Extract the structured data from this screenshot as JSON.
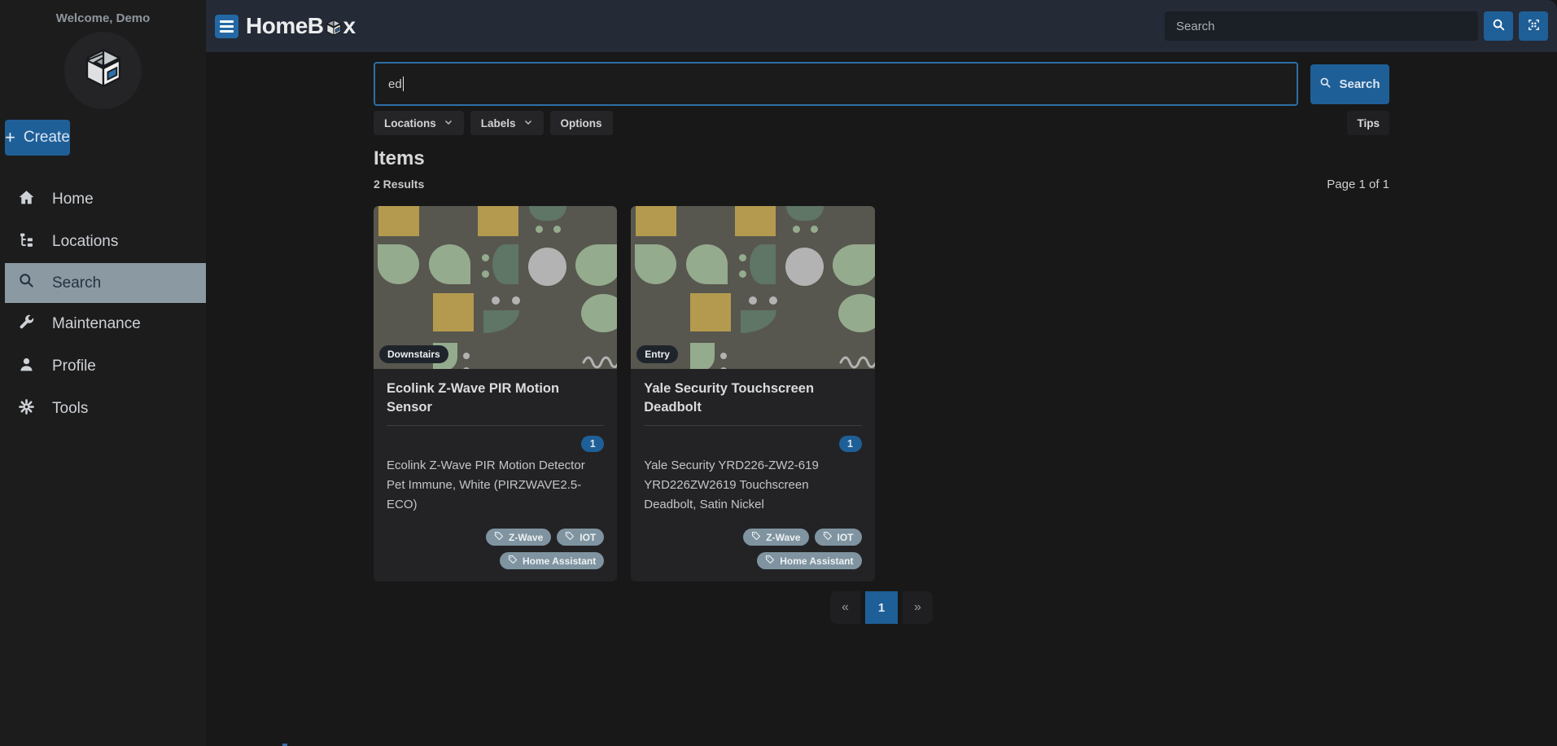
{
  "sidebar": {
    "welcome": "Welcome, Demo",
    "create_label": "Create",
    "items": [
      {
        "label": "Home",
        "icon": "home-icon"
      },
      {
        "label": "Locations",
        "icon": "locations-tree-icon"
      },
      {
        "label": "Search",
        "icon": "search-icon",
        "active": true
      },
      {
        "label": "Maintenance",
        "icon": "wrench-icon"
      },
      {
        "label": "Profile",
        "icon": "user-icon"
      },
      {
        "label": "Tools",
        "icon": "gear-icon"
      }
    ]
  },
  "topbar": {
    "brand_prefix": "HomeB",
    "brand_suffix": "x",
    "search_placeholder": "Search"
  },
  "search": {
    "query": "ed",
    "button_label": "Search",
    "filters": [
      {
        "label": "Locations",
        "has_menu": true
      },
      {
        "label": "Labels",
        "has_menu": true
      },
      {
        "label": "Options",
        "has_menu": false
      }
    ],
    "tips_label": "Tips"
  },
  "results": {
    "heading": "Items",
    "count_text": "2 Results",
    "page_text": "Page 1 of 1"
  },
  "items": [
    {
      "location": "Downstairs",
      "title": "Ecolink Z-Wave PIR Motion Sensor",
      "quantity": "1",
      "description": "Ecolink Z-Wave PIR Motion Detector Pet Immune, White (PIRZWAVE2.5-ECO)",
      "labels": [
        "Z-Wave",
        "IOT",
        "Home Assistant"
      ]
    },
    {
      "location": "Entry",
      "title": "Yale Security Touchscreen Deadbolt",
      "quantity": "1",
      "description": "Yale Security YRD226-ZW2-619 YRD226ZW2619 Touchscreen Deadbolt, Satin Nickel",
      "labels": [
        "Z-Wave",
        "IOT",
        "Home Assistant"
      ]
    }
  ],
  "pagination": {
    "prev": "«",
    "current": "1",
    "next": "»"
  },
  "colors": {
    "accent_blue": "#1f5f97",
    "topbar_bg": "#242a36",
    "active_nav_bg": "#8b99a3",
    "label_chip_bg": "#7f94a0",
    "card_bg": "#232325",
    "pattern_bg": "#57574f",
    "pattern_gold": "#b49a4e",
    "pattern_sage": "#94ab8d",
    "pattern_dark_sage": "#5f7565",
    "pattern_gray": "#b3b3b3"
  }
}
